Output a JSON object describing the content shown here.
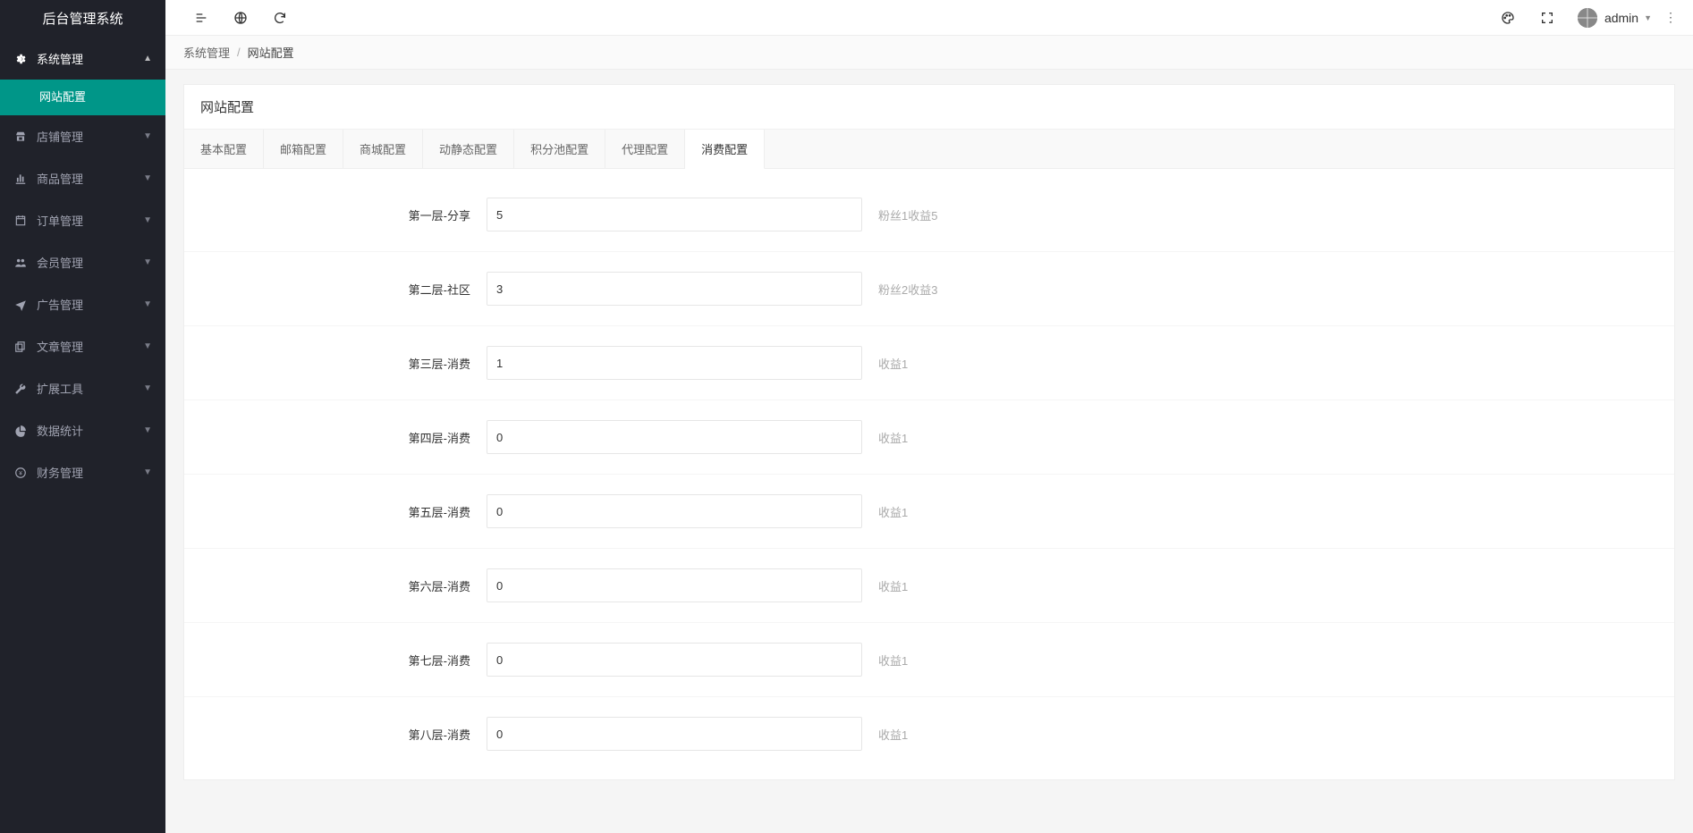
{
  "app_name": "后台管理系统",
  "sidebar": {
    "items": [
      {
        "label": "系统管理",
        "icon": "gear",
        "expanded": true,
        "children": [
          {
            "label": "网站配置",
            "active": true
          }
        ]
      },
      {
        "label": "店铺管理",
        "icon": "store"
      },
      {
        "label": "商品管理",
        "icon": "chart"
      },
      {
        "label": "订单管理",
        "icon": "calendar"
      },
      {
        "label": "会员管理",
        "icon": "users"
      },
      {
        "label": "广告管理",
        "icon": "plane"
      },
      {
        "label": "文章管理",
        "icon": "copy"
      },
      {
        "label": "扩展工具",
        "icon": "wrench"
      },
      {
        "label": "数据统计",
        "icon": "pie"
      },
      {
        "label": "财务管理",
        "icon": "coin"
      }
    ]
  },
  "header": {
    "username": "admin"
  },
  "breadcrumb": {
    "parent": "系统管理",
    "current": "网站配置"
  },
  "card": {
    "title": "网站配置"
  },
  "tabs": [
    {
      "label": "基本配置"
    },
    {
      "label": "邮箱配置"
    },
    {
      "label": "商城配置"
    },
    {
      "label": "动静态配置"
    },
    {
      "label": "积分池配置"
    },
    {
      "label": "代理配置"
    },
    {
      "label": "消费配置",
      "active": true
    }
  ],
  "form": {
    "rows": [
      {
        "label": "第一层-分享",
        "value": "5",
        "hint": "粉丝1收益5"
      },
      {
        "label": "第二层-社区",
        "value": "3",
        "hint": "粉丝2收益3"
      },
      {
        "label": "第三层-消费",
        "value": "1",
        "hint": "收益1"
      },
      {
        "label": "第四层-消费",
        "value": "0",
        "hint": "收益1"
      },
      {
        "label": "第五层-消费",
        "value": "0",
        "hint": "收益1"
      },
      {
        "label": "第六层-消费",
        "value": "0",
        "hint": "收益1"
      },
      {
        "label": "第七层-消费",
        "value": "0",
        "hint": "收益1"
      },
      {
        "label": "第八层-消费",
        "value": "0",
        "hint": "收益1"
      }
    ]
  }
}
